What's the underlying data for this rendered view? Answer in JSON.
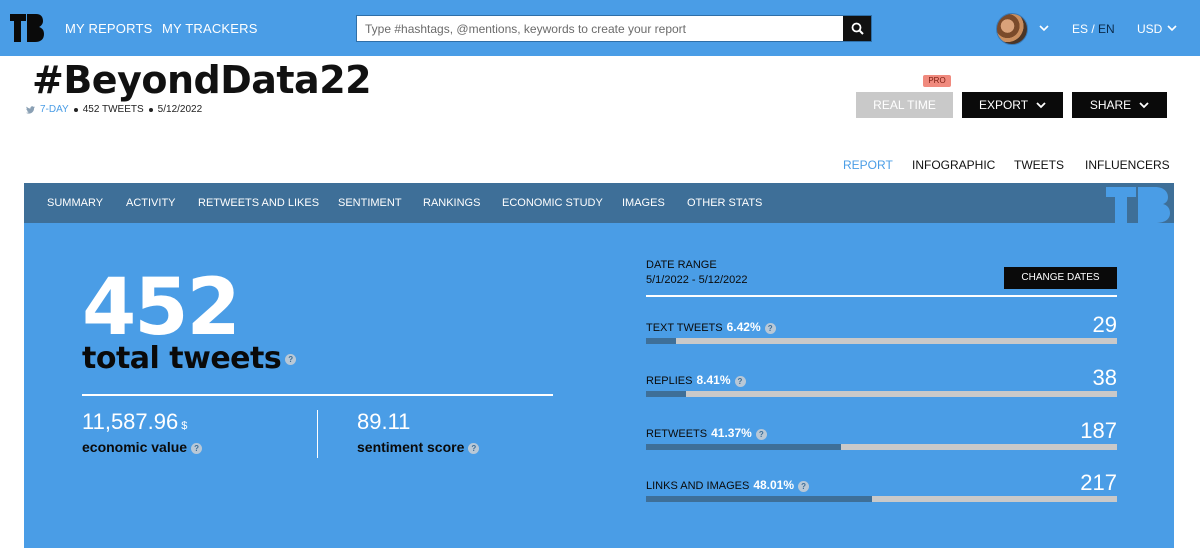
{
  "topbar": {
    "nav": [
      "MY REPORTS",
      "MY TRACKERS"
    ],
    "search_placeholder": "Type #hashtags, @mentions, keywords to create your report",
    "lang_es": "ES",
    "lang_sep": "/",
    "lang_en": "EN",
    "currency": "USD"
  },
  "header": {
    "title": "#BeyondData22",
    "period": "7-DAY",
    "tweets": "452 TWEETS",
    "date": "5/12/2022",
    "pro_badge": "PRO",
    "real_time": "REAL TIME",
    "export": "EXPORT",
    "share": "SHARE"
  },
  "subnav": [
    "REPORT",
    "INFOGRAPHIC",
    "TWEETS",
    "INFLUENCERS"
  ],
  "tabs": [
    "SUMMARY",
    "ACTIVITY",
    "RETWEETS AND LIKES",
    "SENTIMENT",
    "RANKINGS",
    "ECONOMIC STUDY",
    "IMAGES",
    "OTHER STATS"
  ],
  "summary": {
    "total": "452",
    "total_label": "total tweets",
    "economic_value": "11,587.96",
    "economic_unit": "$",
    "economic_label": "economic value",
    "sentiment_value": "89.11",
    "sentiment_label": "sentiment score"
  },
  "date_range": {
    "label": "DATE RANGE",
    "value": "5/1/2022 - 5/12/2022",
    "change": "CHANGE DATES"
  },
  "metrics": [
    {
      "name": "TEXT TWEETS",
      "pct": "6.42%",
      "count": "29",
      "fraction": 0.0642
    },
    {
      "name": "REPLIES",
      "pct": "8.41%",
      "count": "38",
      "fraction": 0.0841
    },
    {
      "name": "RETWEETS",
      "pct": "41.37%",
      "count": "187",
      "fraction": 0.4137
    },
    {
      "name": "LINKS AND IMAGES",
      "pct": "48.01%",
      "count": "217",
      "fraction": 0.4801
    }
  ],
  "colors": {
    "brand_blue": "#4a9de6",
    "tab_bar": "#3e6f98",
    "bar_track": "#c9c9c9",
    "pro_badge": "#f08a7e"
  },
  "icons": [
    "logo-icon",
    "search-icon",
    "chevron-down-icon",
    "twitter-bird-icon",
    "help-icon"
  ]
}
